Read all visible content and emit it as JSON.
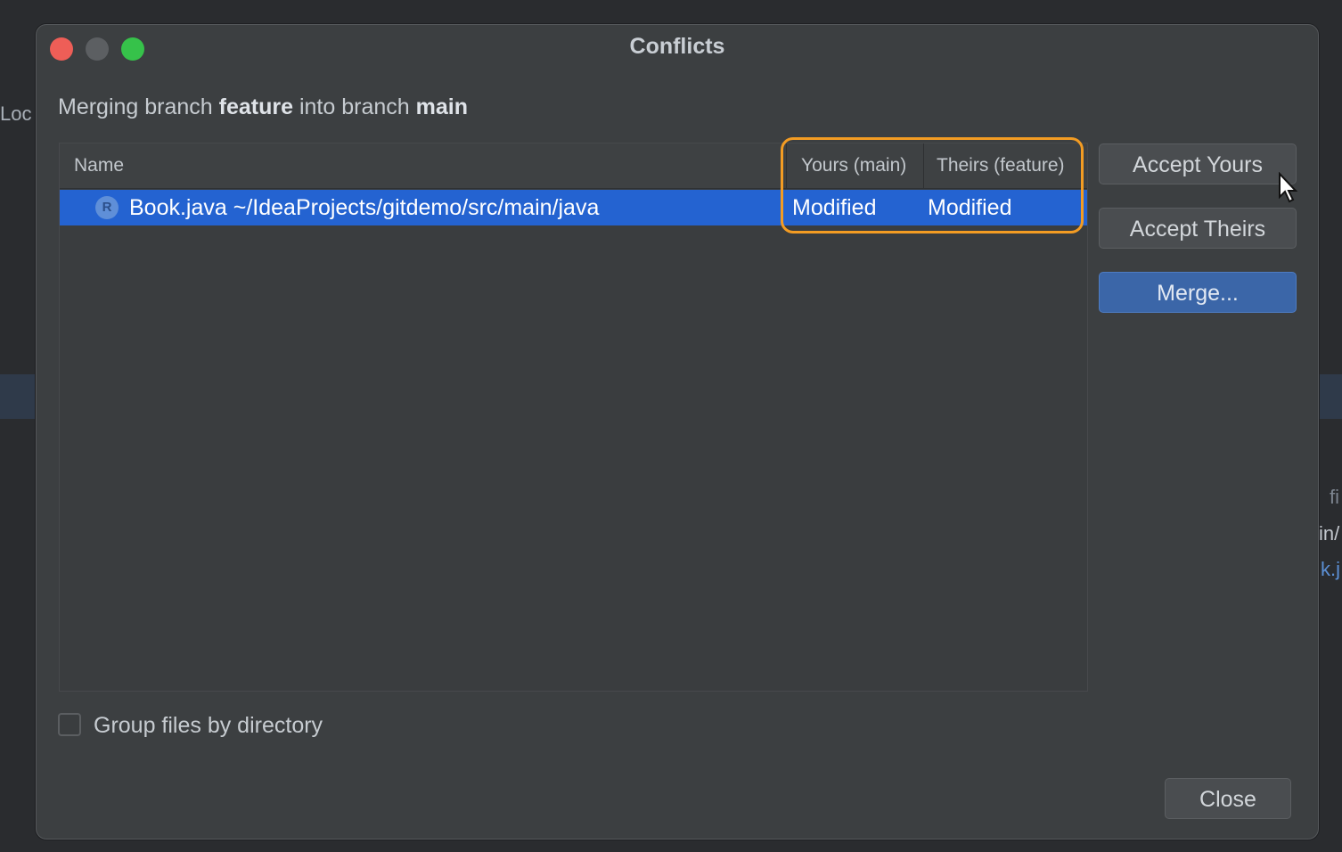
{
  "background": {
    "left_fragment": "Loc",
    "right_fragments": [
      "fi",
      "in/",
      "k.j"
    ]
  },
  "dialog": {
    "title": "Conflicts",
    "subtitle": {
      "prefix": "Merging branch ",
      "source_branch": "feature",
      "middle": " into branch ",
      "target_branch": "main"
    },
    "table": {
      "columns": {
        "name": "Name",
        "yours": "Yours (main)",
        "theirs": "Theirs (feature)"
      },
      "rows": [
        {
          "icon_letter": "R",
          "name": "Book.java  ~/IdeaProjects/gitdemo/src/main/java",
          "yours": "Modified",
          "theirs": "Modified",
          "selected": true
        }
      ]
    },
    "buttons": {
      "accept_yours": "Accept Yours",
      "accept_theirs": "Accept Theirs",
      "merge": "Merge...",
      "close": "Close"
    },
    "group_files_label": "Group files by directory",
    "colors": {
      "selection": "#2463d1",
      "highlight": "#f39c23",
      "merge_button": "#3b66a8"
    }
  }
}
